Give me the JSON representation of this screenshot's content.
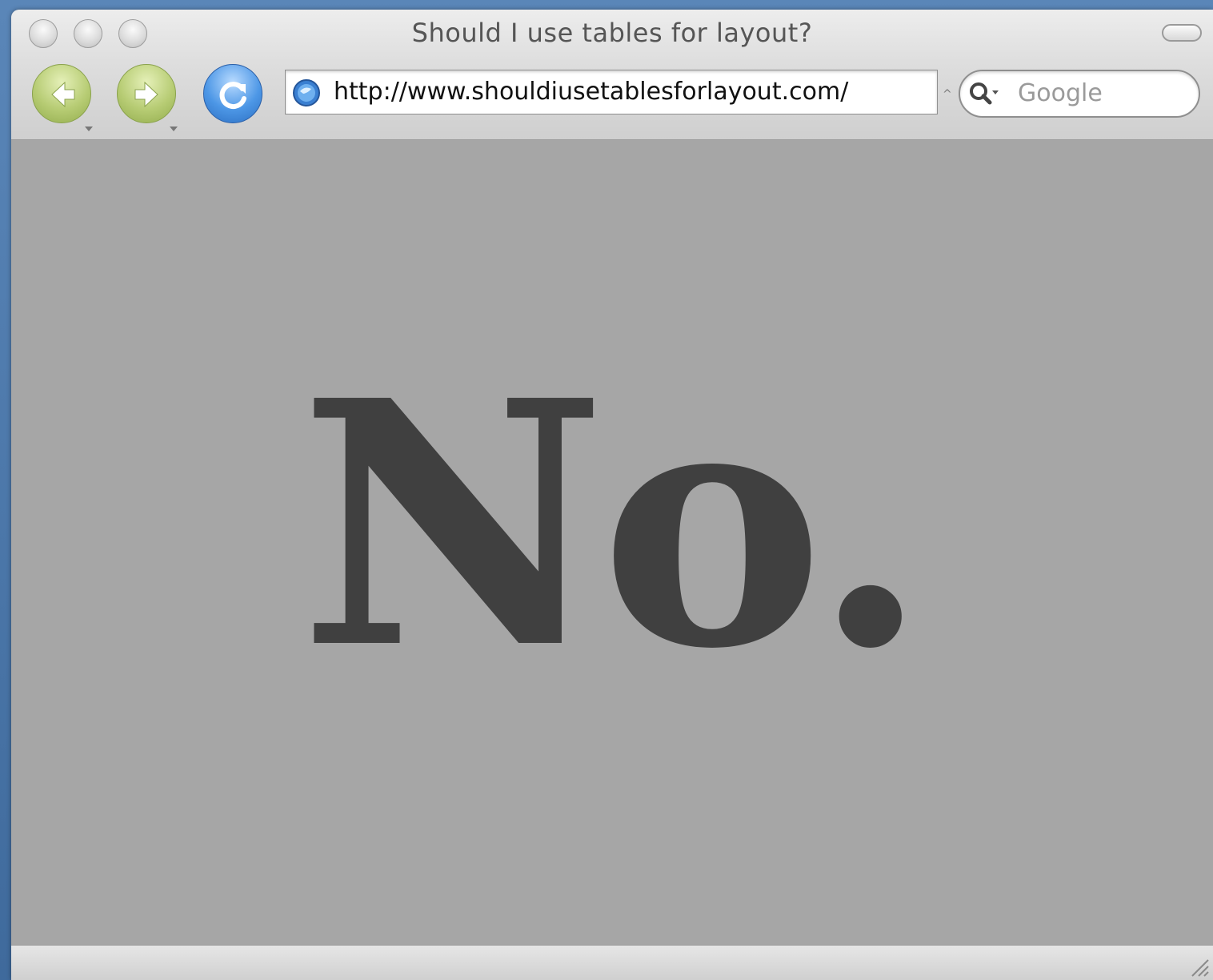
{
  "window": {
    "title": "Should I use tables for layout?"
  },
  "toolbar": {
    "back_icon": "back-arrow-icon",
    "forward_icon": "forward-arrow-icon",
    "reload_icon": "reload-icon",
    "url": "http://www.shouldiusetablesforlayout.com/",
    "search_placeholder": "Google"
  },
  "page": {
    "answer": "No."
  },
  "colors": {
    "page_background": "#a6a6a6",
    "answer_text": "#404040",
    "nav_green": "#b7cc74",
    "reload_blue": "#4d97e6",
    "desktop_blue": "#4f79a8"
  }
}
